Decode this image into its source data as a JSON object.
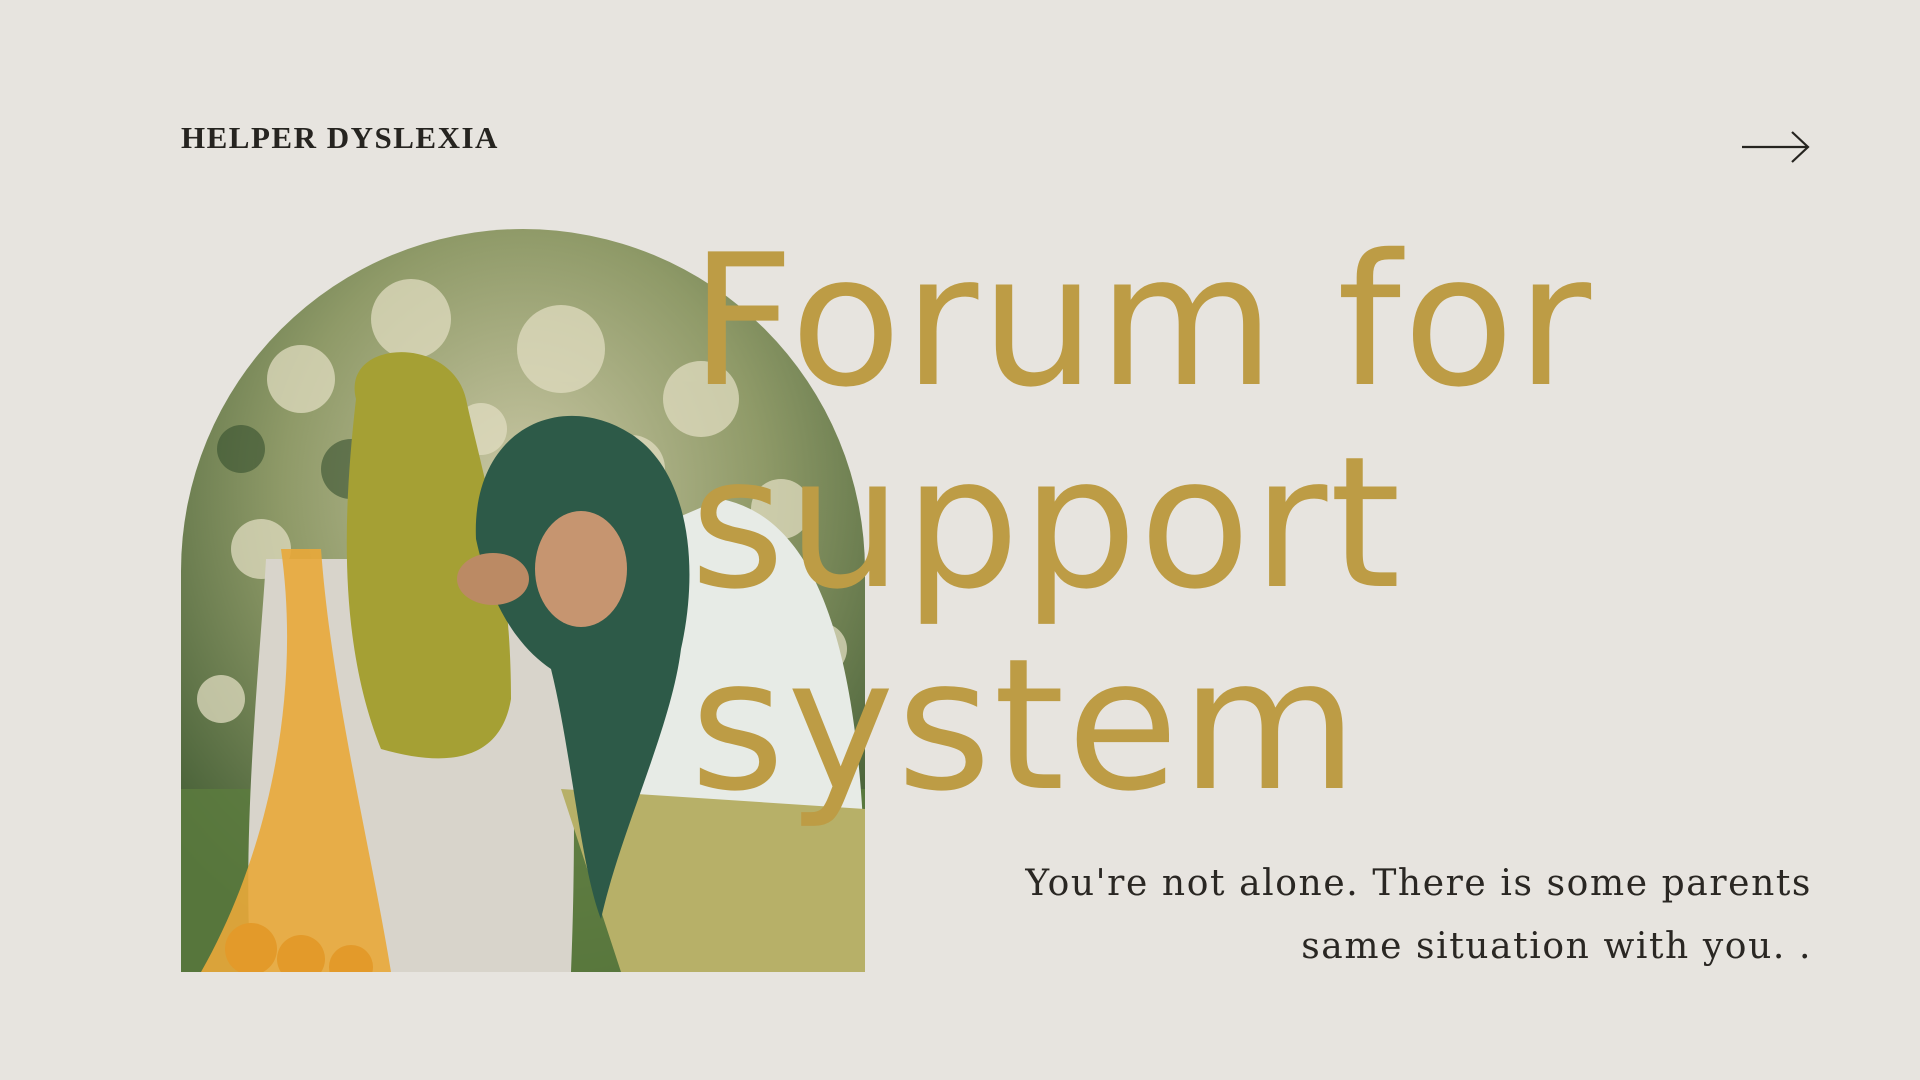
{
  "slide": {
    "brand": "HELPER DYSLEXIA",
    "headline_lines": [
      "Forum for",
      "support",
      "system"
    ],
    "subtext": "You're not alone. There is some parents same situation with you. .",
    "next_icon": "arrow-right-icon",
    "photo_icon": "photo-two-women-in-hijabs"
  },
  "colors": {
    "background": "#e7e4df",
    "accent_gold": "#bd9c45",
    "text_dark": "#262420"
  }
}
